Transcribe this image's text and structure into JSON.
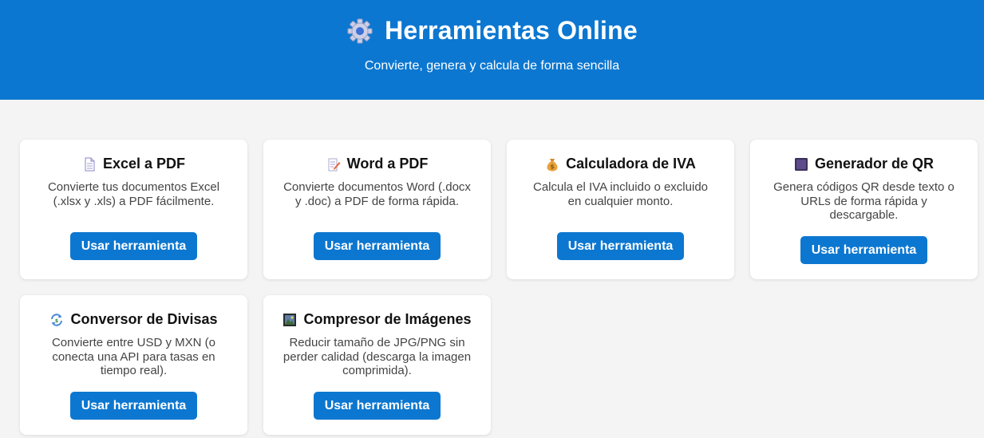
{
  "header": {
    "title": "Herramientas Online",
    "subtitle": "Convierte, genera y calcula de forma sencilla",
    "icon": "gear-icon"
  },
  "colors": {
    "header_bg": "#0c77d0",
    "button_bg": "#0c77d0",
    "page_bg": "#f4f4f4",
    "card_bg": "#ffffff"
  },
  "tools": [
    {
      "title": "Excel a PDF",
      "icon": "document-icon",
      "description": "Convierte tus documentos Excel (.xlsx y .xls) a PDF fácilmente.",
      "button": "Usar herramienta"
    },
    {
      "title": "Word a PDF",
      "icon": "memo-icon",
      "description": "Convierte documentos Word (.docx y .doc) a PDF de forma rápida.",
      "button": "Usar herramienta"
    },
    {
      "title": "Calculadora de IVA",
      "icon": "money-bag-icon",
      "description": "Calcula el IVA incluido o excluido en cualquier monto.",
      "button": "Usar herramienta"
    },
    {
      "title": "Generador de QR",
      "icon": "qr-square-icon",
      "description": "Genera códigos QR desde texto o URLs de forma rápida y descargable.",
      "button": "Usar herramienta"
    },
    {
      "title": "Conversor de Divisas",
      "icon": "exchange-arrows-icon",
      "description": "Convierte entre USD y MXN (o conecta una API para tasas en tiempo real).",
      "button": "Usar herramienta"
    },
    {
      "title": "Compresor de Imágenes",
      "icon": "framed-picture-icon",
      "description": "Reducir tamaño de JPG/PNG sin perder calidad (descarga la imagen comprimida).",
      "button": "Usar herramienta"
    }
  ]
}
